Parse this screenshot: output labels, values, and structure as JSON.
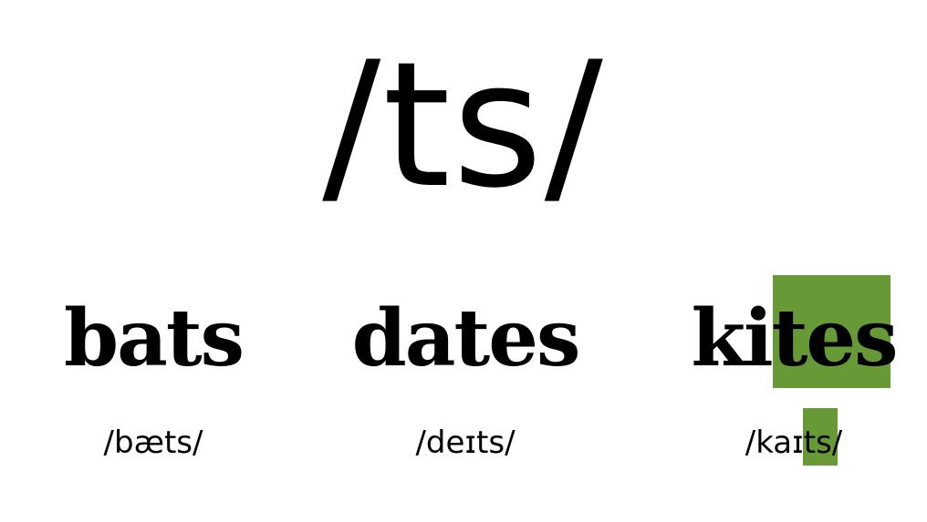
{
  "title": "/ts/",
  "highlight_color": "#679a37",
  "words": [
    {
      "word": "bats",
      "ipa": "/bæts/"
    },
    {
      "word": "dates",
      "ipa": "/deɪts/"
    },
    {
      "word": "kites",
      "ipa": "/kaɪts/"
    }
  ],
  "highlights": {
    "word": "tes",
    "ipa": "ts"
  }
}
